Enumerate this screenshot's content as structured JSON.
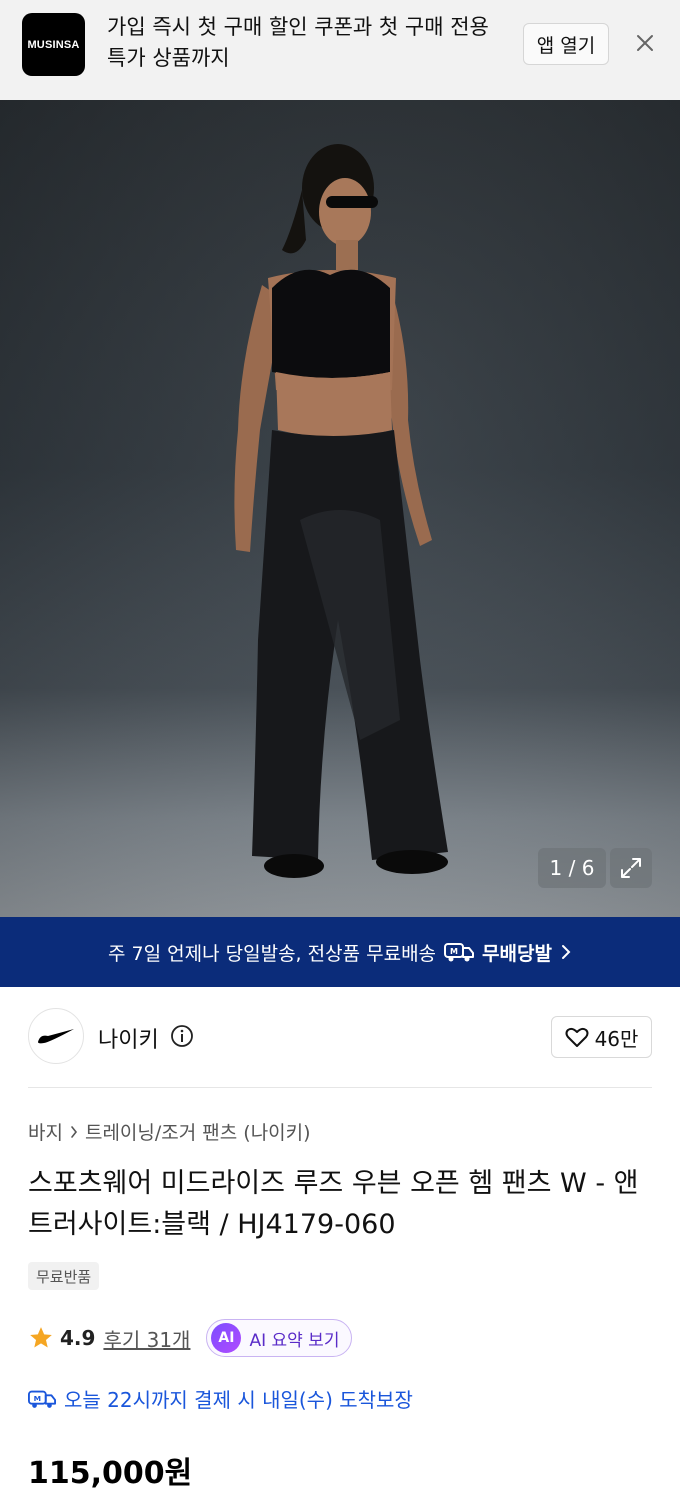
{
  "banner": {
    "logo_text": "MUSINSA",
    "message": "가입 즉시 첫 구매 할인 쿠폰과 첫 구매 전용 특가 상품까지",
    "open_label": "앱 열기"
  },
  "gallery": {
    "counter": "1 / 6"
  },
  "delivery_strip": {
    "text": "주 7일 언제나 당일발송, 전상품 무료배송",
    "brand": "무배당발"
  },
  "brand": {
    "name": "나이키",
    "likes": "46만"
  },
  "product": {
    "breadcrumb": [
      "바지",
      "트레이닝/조거 팬츠 (나이키)"
    ],
    "title": "스포츠웨어 미드라이즈 루즈 우븐 오픈 헴 팬츠 W - 앤트러사이트:블랙 / HJ4179-060",
    "badge": "무료반품",
    "rating": "4.9",
    "reviews": "후기 31개",
    "ai_badge": "AI",
    "ai_label": "AI 요약 보기",
    "arrival": "오늘 22시까지 결제 시 내일(수) 도착보장",
    "price": "115,000원"
  },
  "colors": {
    "strip_bg": "#0b2c7a",
    "accent_blue": "#1a56db",
    "star": "#f5a623",
    "ai_purple": "#5a2cc8"
  }
}
